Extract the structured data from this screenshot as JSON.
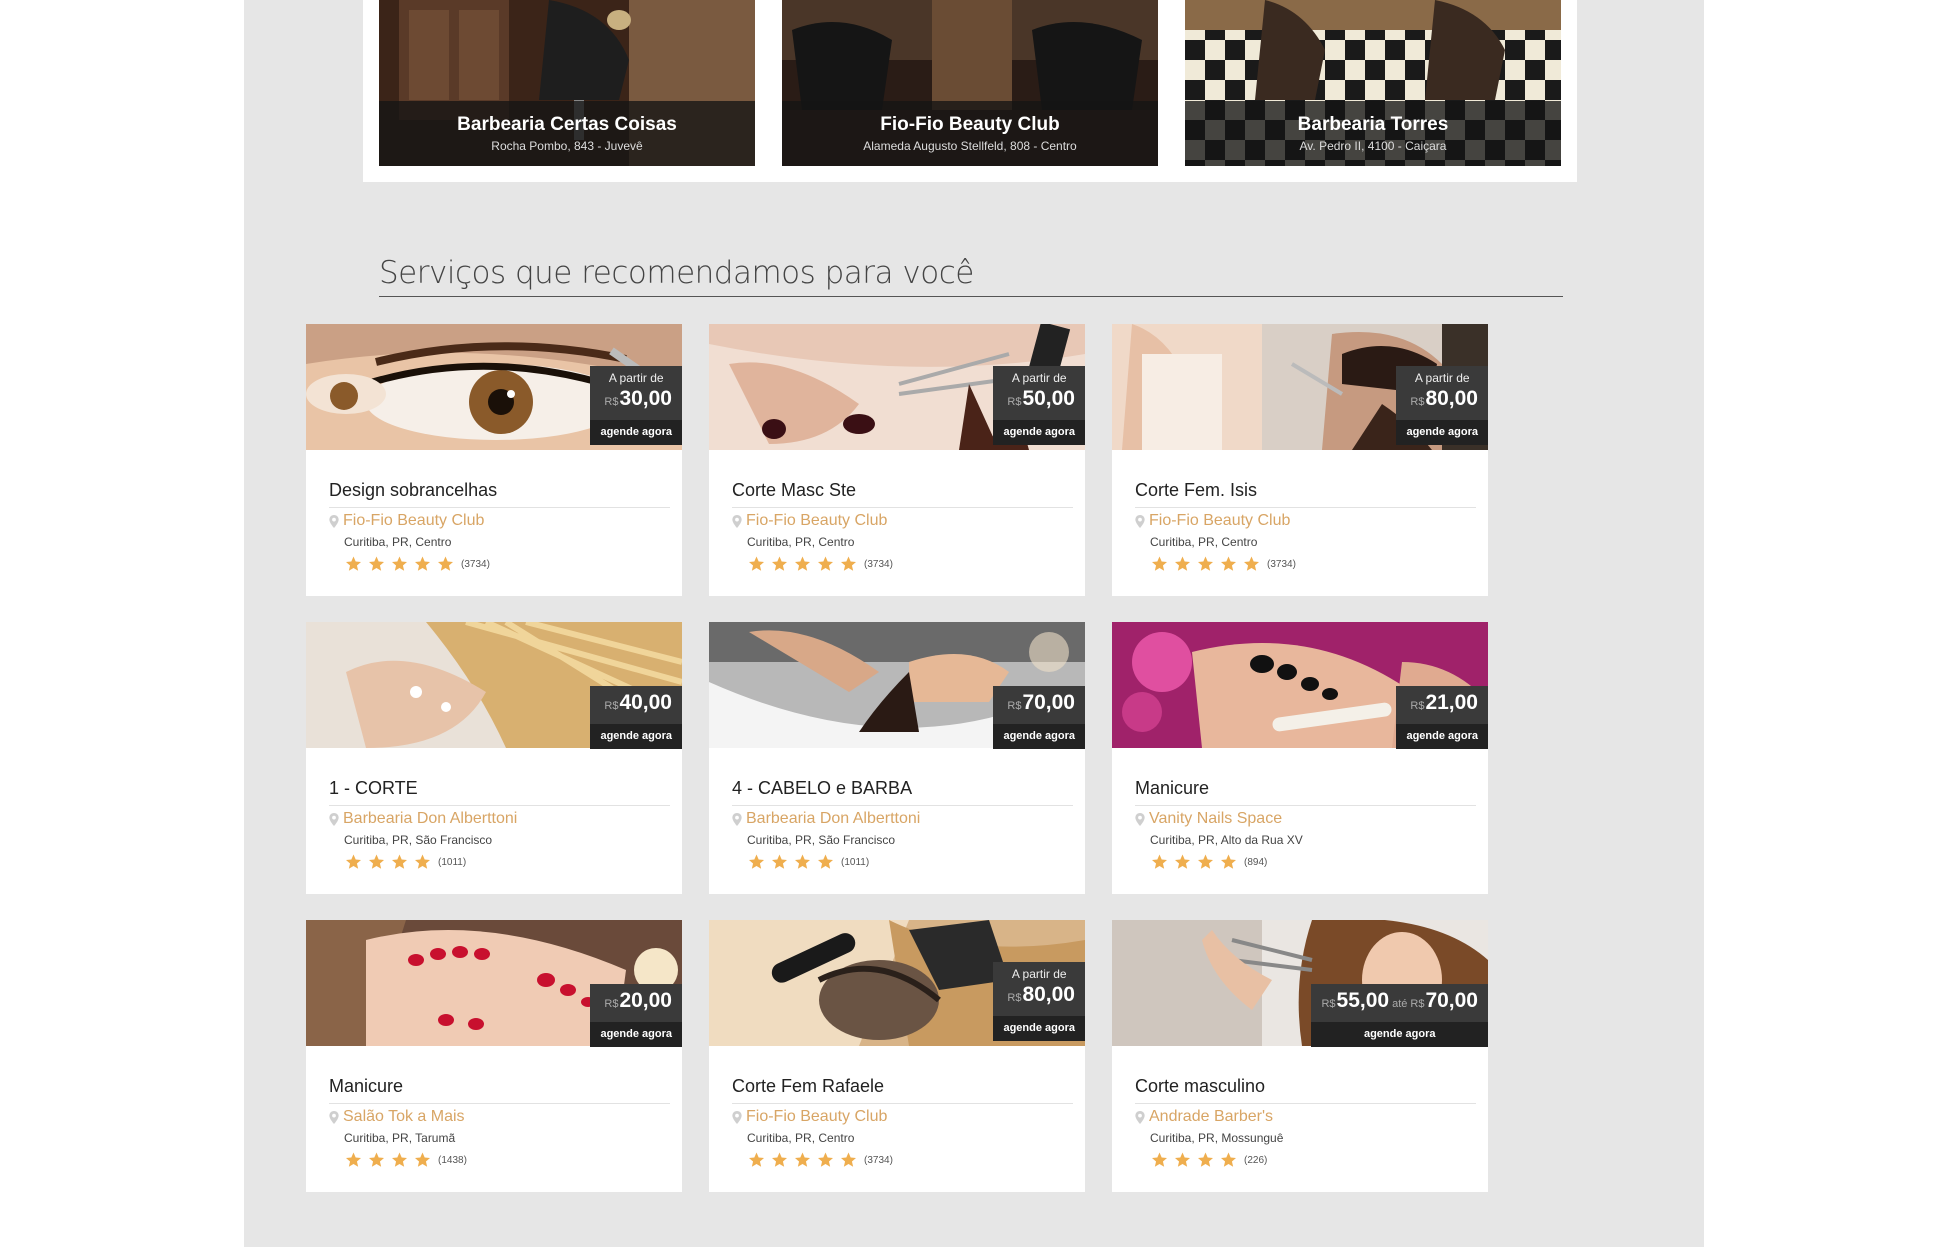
{
  "featured": [
    {
      "name": "Barbearia Certas Coisas",
      "address": "Rocha Pombo, 843 - Juvevê"
    },
    {
      "name": "Fio-Fio Beauty Club",
      "address": "Alameda Augusto Stellfeld, 808 - Centro"
    },
    {
      "name": "Barbearia Torres",
      "address": "Av. Pedro II, 4100 - Caiçara"
    }
  ],
  "section": {
    "title": "Serviços que recomendamos para você"
  },
  "currency": "R$",
  "from_label": "A partir de",
  "until_label": "até",
  "book_label": "agende agora",
  "services": [
    {
      "title": "Design sobrancelhas",
      "from": true,
      "price": "30,00",
      "salon": "Fio-Fio Beauty Club",
      "location": "Curitiba, PR, Centro",
      "stars": 5,
      "count": "(3734)",
      "photo": "eye"
    },
    {
      "title": "Corte Masc Ste",
      "from": true,
      "price": "50,00",
      "salon": "Fio-Fio Beauty Club",
      "location": "Curitiba, PR, Centro",
      "stars": 5,
      "count": "(3734)",
      "photo": "hair-cut"
    },
    {
      "title": "Corte Fem. Isis",
      "from": true,
      "price": "80,00",
      "salon": "Fio-Fio Beauty Club",
      "location": "Curitiba, PR, Centro",
      "stars": 5,
      "count": "(3734)",
      "photo": "barber"
    },
    {
      "title": "1 - CORTE",
      "from": false,
      "price": "40,00",
      "salon": "Barbearia Don Alberttoni",
      "location": "Curitiba, PR, São Francisco",
      "stars": 4,
      "count": "(1011)",
      "photo": "wash"
    },
    {
      "title": "4 - CABELO e BARBA",
      "from": false,
      "price": "70,00",
      "salon": "Barbearia Don Alberttoni",
      "location": "Curitiba, PR, São Francisco",
      "stars": 4,
      "count": "(1011)",
      "photo": "sink"
    },
    {
      "title": "Manicure",
      "from": false,
      "price": "21,00",
      "salon": "Vanity Nails Space",
      "location": "Curitiba, PR, Alto da Rua XV",
      "stars": 4,
      "count": "(894)",
      "photo": "pedicure"
    },
    {
      "title": "Manicure",
      "from": false,
      "price": "20,00",
      "salon": "Salão Tok a Mais",
      "location": "Curitiba, PR, Tarumã",
      "stars": 4,
      "count": "(1438)",
      "photo": "red-nails"
    },
    {
      "title": "Corte Fem Rafaele",
      "from": true,
      "price": "80,00",
      "salon": "Fio-Fio Beauty Club",
      "location": "Curitiba, PR, Centro",
      "stars": 5,
      "count": "(3734)",
      "photo": "brush"
    },
    {
      "title": "Corte masculino",
      "from": false,
      "price": "55,00",
      "price_max": "70,00",
      "salon": "Andrade Barber's",
      "location": "Curitiba, PR, Mossunguê",
      "stars": 4,
      "count": "(226)",
      "photo": "woman"
    }
  ],
  "colors": {
    "accent": "#d8a565",
    "star": "#efae4e",
    "dark": "#222222"
  }
}
